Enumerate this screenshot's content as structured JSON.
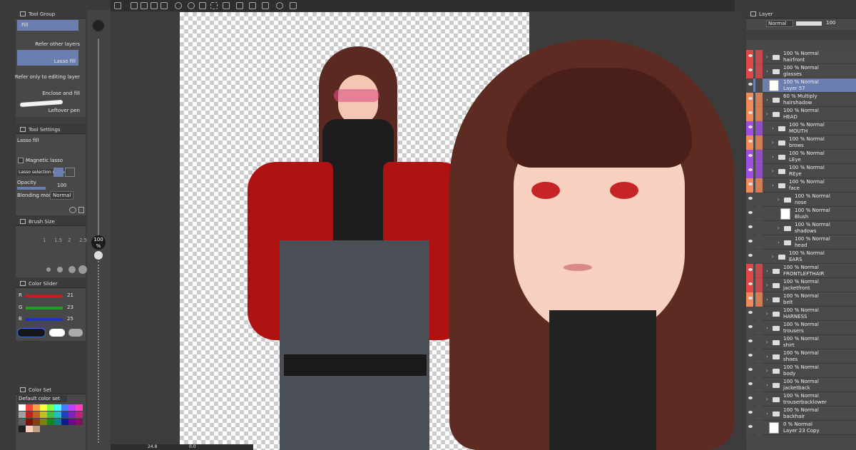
{
  "toolbar": {
    "zoom": "24.8",
    "rotation": "0.0"
  },
  "tool_group": {
    "title": "Tool Group",
    "tools": [
      {
        "label": "Fill"
      },
      {
        "label": "Refer other layers"
      },
      {
        "label": "Lasso fill"
      },
      {
        "label": "Refer only to editing layer"
      },
      {
        "label": "Enclose and fill"
      },
      {
        "label": "Leftover pen"
      }
    ]
  },
  "tool_settings": {
    "title": "Tool Settings",
    "tool_name": "Lasso fill",
    "magnetic_lasso": "Magnetic lasso",
    "selection_mode_label": "Lasso selection mode",
    "opacity_label": "Opacity",
    "opacity_value": "100",
    "blending_label": "Blending mode",
    "blending_value": "Normal"
  },
  "brush_size": {
    "title": "Brush Size",
    "labels": [
      "1",
      "1.5",
      "2",
      "2.5"
    ]
  },
  "color_slider": {
    "title": "Color Slider",
    "channels": [
      {
        "name": "R",
        "value": "21",
        "color": "#c02020"
      },
      {
        "name": "G",
        "value": "23",
        "color": "#20a020"
      },
      {
        "name": "B",
        "value": "25",
        "color": "#2030c0"
      }
    ]
  },
  "color_set": {
    "title": "Color Set",
    "name": "Default color set"
  },
  "size_slider": {
    "value": "100",
    "unit": "%"
  },
  "layer_panel": {
    "title": "Layer",
    "blend_mode": "Normal",
    "opacity": "100",
    "layers": [
      {
        "l1": "100 % Normal",
        "l2": "hairfront",
        "color": "#e04848",
        "folder": true,
        "indent": 0
      },
      {
        "l1": "100 % Normal",
        "l2": "glasses",
        "color": "#e04848",
        "folder": true,
        "indent": 0
      },
      {
        "l1": "100 % Normal",
        "l2": "Layer 57",
        "color": "",
        "folder": false,
        "indent": 0,
        "selected": true
      },
      {
        "l1": "60 % Multiply",
        "l2": "hairshadow",
        "color": "#f08a58",
        "folder": true,
        "indent": 0
      },
      {
        "l1": "100 % Normal",
        "l2": "HEAD",
        "color": "#f08a58",
        "folder": true,
        "indent": 0
      },
      {
        "l1": "100 % Normal",
        "l2": "MOUTH",
        "color": "#a050e0",
        "folder": true,
        "indent": 1
      },
      {
        "l1": "100 % Normal",
        "l2": "brows",
        "color": "#f08a58",
        "folder": true,
        "indent": 1
      },
      {
        "l1": "100 % Normal",
        "l2": "LEye",
        "color": "#a050e0",
        "folder": true,
        "indent": 1
      },
      {
        "l1": "100 % Normal",
        "l2": "REye",
        "color": "#a050e0",
        "folder": true,
        "indent": 1
      },
      {
        "l1": "100 % Normal",
        "l2": "face",
        "color": "#f08a58",
        "folder": true,
        "indent": 1
      },
      {
        "l1": "100 % Normal",
        "l2": "nose",
        "color": "",
        "folder": true,
        "indent": 2
      },
      {
        "l1": "100 % Normal",
        "l2": "Blush",
        "color": "",
        "folder": false,
        "indent": 2
      },
      {
        "l1": "100 % Normal",
        "l2": "shadows",
        "color": "",
        "folder": true,
        "indent": 2
      },
      {
        "l1": "100 % Normal",
        "l2": "head",
        "color": "",
        "folder": true,
        "indent": 2
      },
      {
        "l1": "100 % Normal",
        "l2": "EARS",
        "color": "",
        "folder": true,
        "indent": 1
      },
      {
        "l1": "100 % Normal",
        "l2": "FRONTLEFTHAIR",
        "color": "#e04848",
        "folder": true,
        "indent": 0
      },
      {
        "l1": "100 % Normal",
        "l2": "jacketfront",
        "color": "#e04848",
        "folder": true,
        "indent": 0
      },
      {
        "l1": "100 % Normal",
        "l2": "belt",
        "color": "#f08a58",
        "folder": true,
        "indent": 0
      },
      {
        "l1": "100 % Normal",
        "l2": "HARNESS",
        "color": "",
        "folder": true,
        "indent": 0
      },
      {
        "l1": "100 % Normal",
        "l2": "trousers",
        "color": "",
        "folder": true,
        "indent": 0
      },
      {
        "l1": "100 % Normal",
        "l2": "shirt",
        "color": "",
        "folder": true,
        "indent": 0
      },
      {
        "l1": "100 % Normal",
        "l2": "shoes",
        "color": "",
        "folder": true,
        "indent": 0
      },
      {
        "l1": "100 % Normal",
        "l2": "body",
        "color": "",
        "folder": true,
        "indent": 0
      },
      {
        "l1": "100 % Normal",
        "l2": "jacketback",
        "color": "",
        "folder": true,
        "indent": 0
      },
      {
        "l1": "100 % Normal",
        "l2": "trouserbacklower",
        "color": "",
        "folder": true,
        "indent": 0
      },
      {
        "l1": "100 % Normal",
        "l2": "backhair",
        "color": "",
        "folder": true,
        "indent": 0
      },
      {
        "l1": "0 % Normal",
        "l2": "Layer 23 Copy",
        "color": "",
        "folder": false,
        "indent": 0
      }
    ]
  }
}
